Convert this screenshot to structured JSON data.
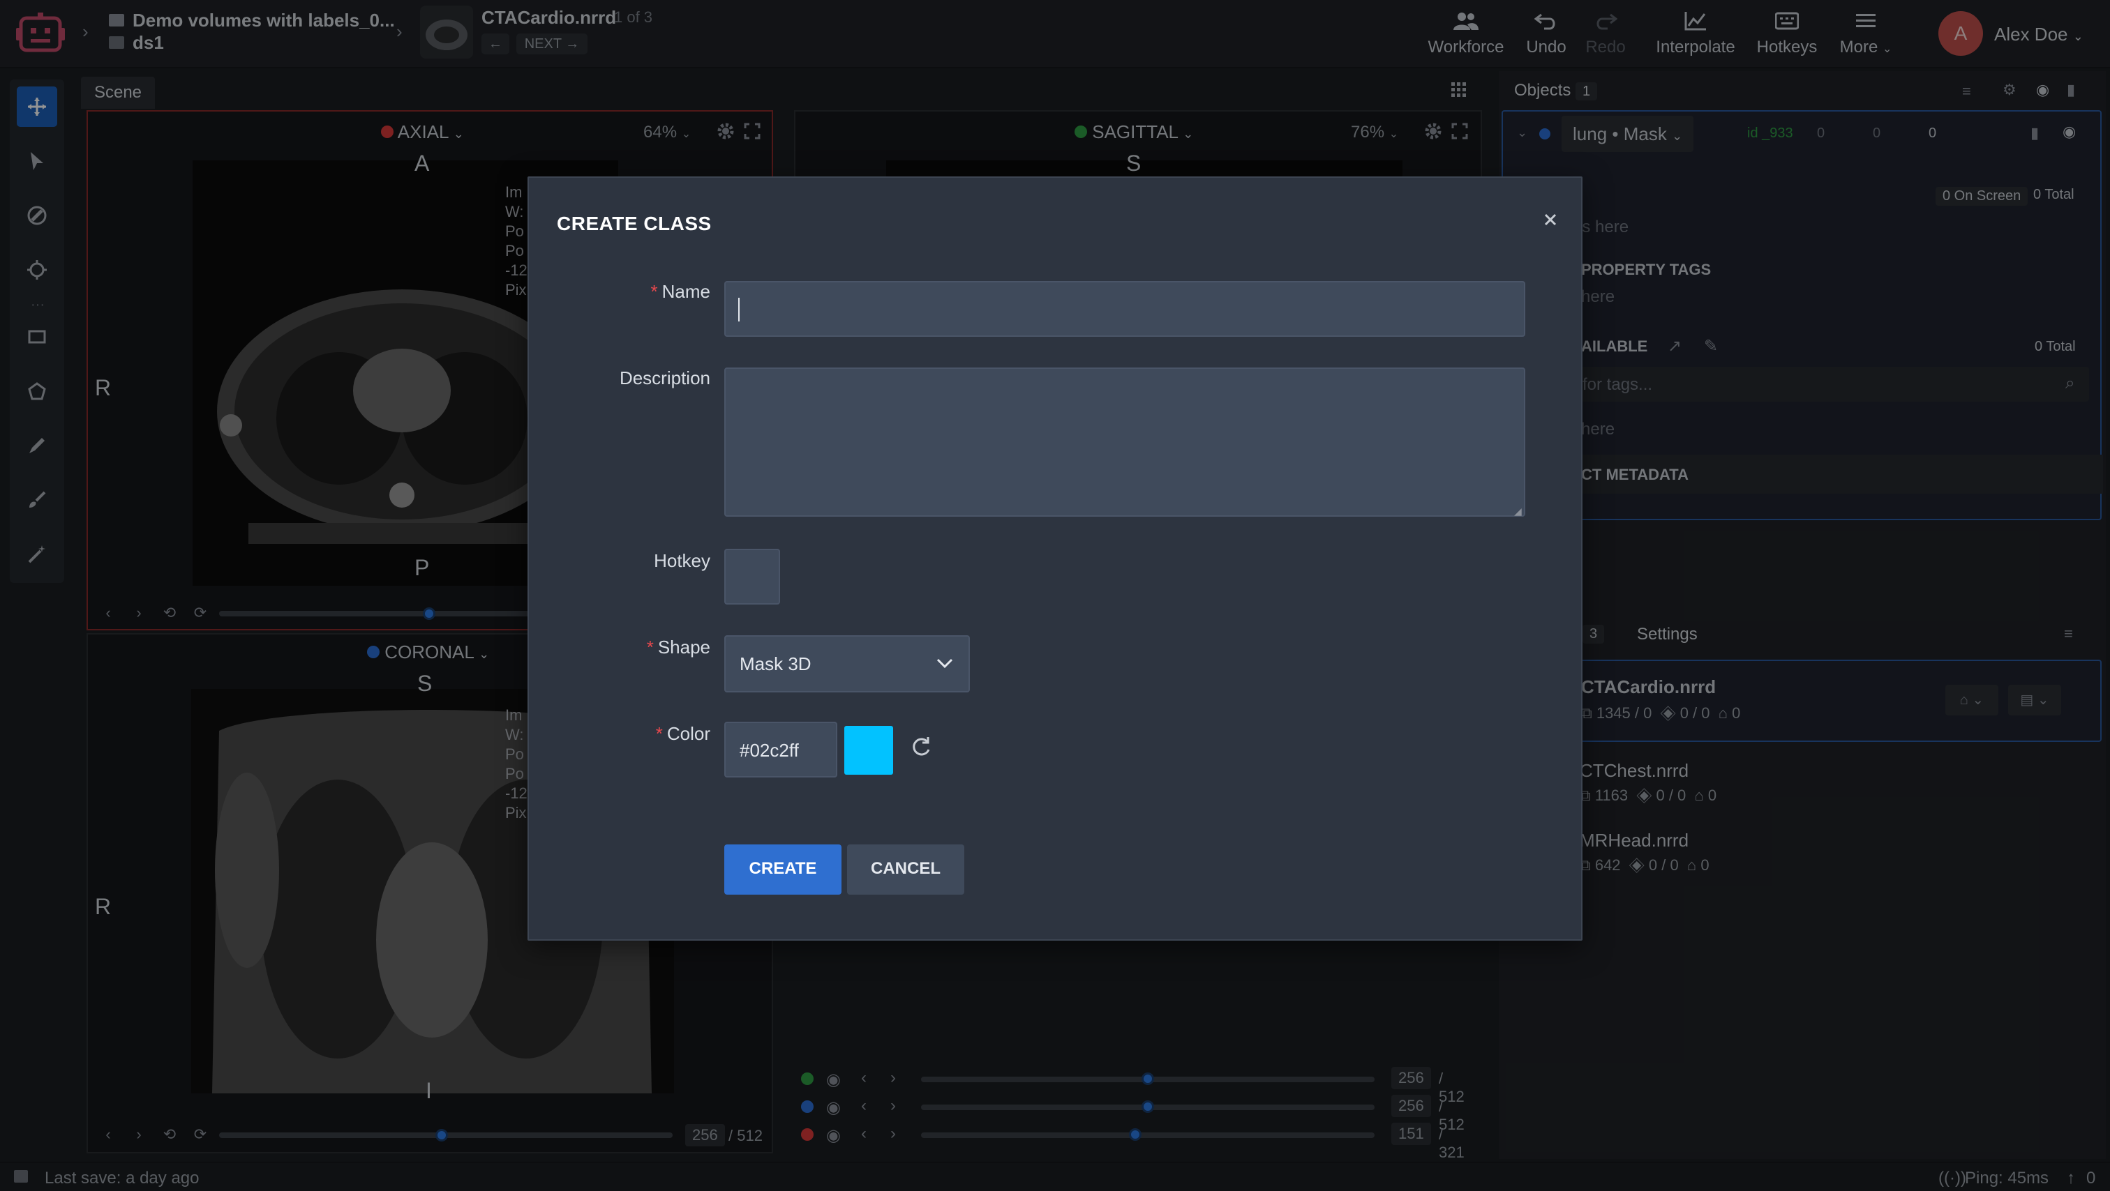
{
  "header": {
    "breadcrumb_project": "Demo volumes with labels_0...",
    "breadcrumb_dataset": "ds1",
    "file_name": "CTACardio.nrrd",
    "file_position": "1 of 3",
    "prev_label": "←",
    "next_label": "NEXT →",
    "tools": [
      {
        "label": "Workforce",
        "icon": "users-icon"
      },
      {
        "label": "Undo",
        "icon": "undo-icon"
      },
      {
        "label": "Redo",
        "icon": "redo-icon"
      },
      {
        "label": "Interpolate",
        "icon": "chart-icon"
      },
      {
        "label": "Hotkeys",
        "icon": "keyboard-icon"
      },
      {
        "label": "More",
        "icon": "menu-icon"
      }
    ],
    "user_initial": "A",
    "user_name": "Alex Doe"
  },
  "scene": {
    "tab_label": "Scene",
    "axial": {
      "title": "AXIAL",
      "zoom": "64%",
      "top": "A",
      "bottom": "P",
      "left": "R",
      "color": "#d93a3a"
    },
    "sagittal": {
      "title": "SAGITTAL",
      "zoom": "76%",
      "top": "S",
      "color": "#2f9e44"
    },
    "coronal": {
      "title": "CORONAL",
      "top": "S",
      "bottom": "I",
      "left": "R",
      "color": "#2c6fd6",
      "slice": "256",
      "slice_total": "/ 512"
    },
    "axial_overlay_lines": [
      "Im",
      "W:",
      "Po",
      "Po",
      "-12",
      "Pix"
    ],
    "coronal_overlay_lines": [
      "Im",
      "W:",
      "Po",
      "Po",
      "-12",
      "Pix"
    ],
    "sliders": [
      {
        "color": "#2f9e44",
        "value": "256",
        "total": "/ 512",
        "fill": 0.5
      },
      {
        "color": "#2c6fd6",
        "value": "256",
        "total": "/ 512",
        "fill": 0.5
      },
      {
        "color": "#d93a3a",
        "value": "151",
        "total": "/ 321",
        "fill": 0.47
      }
    ]
  },
  "objects_panel": {
    "title": "Objects",
    "count": "1",
    "object_label": "lung • Mask",
    "object_id": "id _933",
    "stat1": "0",
    "stat2": "0",
    "stat3": "0",
    "on_screen": "0 On Screen",
    "total": "0 Total",
    "tags_placeholder_partial": "es here",
    "property_tags_partial": "PROPERTY TAGS",
    "property_here_partial": "here",
    "available_partial": "AILABLE",
    "available_total": "0 Total",
    "search_partial": "for tags...",
    "here2_partial": "here",
    "metadata_partial": "CT METADATA"
  },
  "files_panel": {
    "tab_count": "3",
    "settings_label": "Settings",
    "files": [
      {
        "name": "CTACardio.nrrd",
        "frames": "1345 / 0",
        "figures": "0 / 0",
        "tags": "0"
      },
      {
        "name": "CTChest.nrrd",
        "frames": "1163",
        "figures": "0 / 0",
        "tags": "0"
      },
      {
        "name": "MRHead.nrrd",
        "frames": "642",
        "figures": "0 / 0",
        "tags": "0"
      }
    ]
  },
  "modal": {
    "title": "CREATE CLASS",
    "name_label": "Name",
    "name_value": "",
    "description_label": "Description",
    "description_value": "",
    "hotkey_label": "Hotkey",
    "hotkey_value": "",
    "shape_label": "Shape",
    "shape_value": "Mask 3D",
    "color_label": "Color",
    "color_value": "#02c2ff",
    "create_label": "CREATE",
    "cancel_label": "CANCEL"
  },
  "status": {
    "last_save": "Last save: a day ago",
    "ping": "Ping: 45ms",
    "uploads": "0"
  }
}
